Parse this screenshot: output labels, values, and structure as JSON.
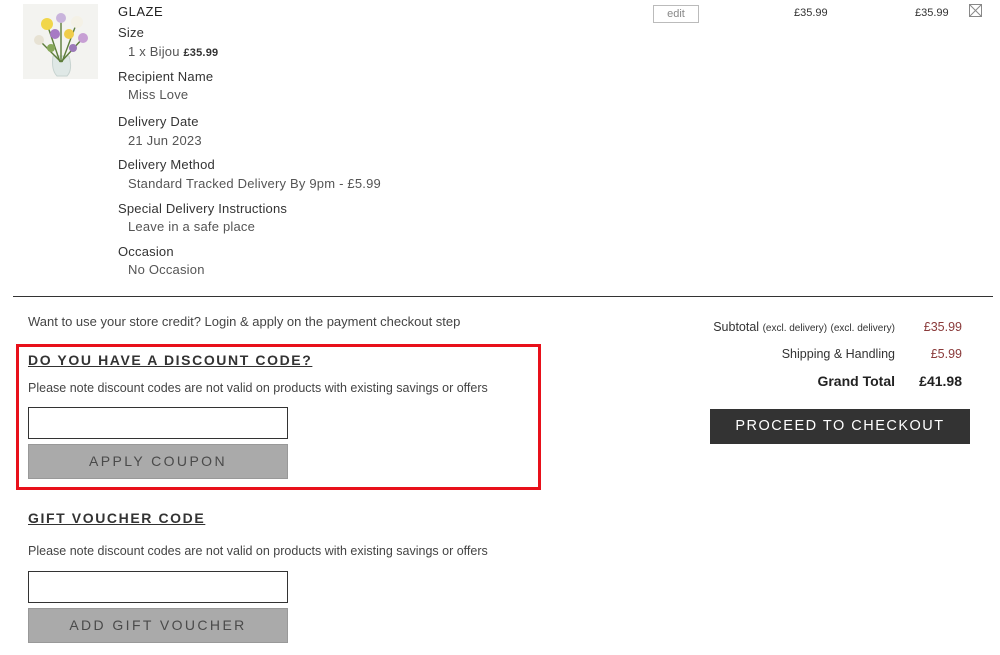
{
  "item": {
    "name": "GLAZE",
    "image_icon": "flower-bouquet-image",
    "edit_label": "edit",
    "unit_price": "£35.99",
    "row_total": "£35.99",
    "remove_icon": "close-box-icon",
    "options": [
      {
        "label": "Size",
        "value": "1 x Bijou",
        "value_extra": "£35.99"
      },
      {
        "label": "Recipient Name",
        "value": "Miss Love"
      },
      {
        "label": "Delivery Date",
        "value": "21 Jun 2023"
      },
      {
        "label": "Delivery Method",
        "value": "Standard Tracked Delivery By 9pm - £5.99"
      },
      {
        "label": "Special Delivery Instructions",
        "value": "Leave in a safe place"
      },
      {
        "label": "Occasion",
        "value": "No Occasion"
      }
    ]
  },
  "store_credit_note": "Want to use your store credit? Login & apply on the payment checkout step",
  "discount": {
    "heading": "DO YOU HAVE A DISCOUNT CODE?",
    "note": "Please note discount codes are not valid on products with existing savings or offers",
    "input_value": "",
    "button_label": "APPLY COUPON",
    "highlight_color": "#e8101a"
  },
  "voucher": {
    "heading": "GIFT VOUCHER CODE",
    "note": "Please note discount codes are not valid on products with existing savings or offers",
    "input_value": "",
    "button_label": "ADD GIFT VOUCHER"
  },
  "summary": {
    "subtotal_label": "Subtotal",
    "subtotal_qualifier_1": "(excl. delivery)",
    "subtotal_qualifier_2": "(excl. delivery)",
    "subtotal_value": "£35.99",
    "shipping_label": "Shipping & Handling",
    "shipping_value": "£5.99",
    "grand_total_label": "Grand Total",
    "grand_total_value": "£41.98",
    "checkout_label": "PROCEED TO CHECKOUT"
  }
}
